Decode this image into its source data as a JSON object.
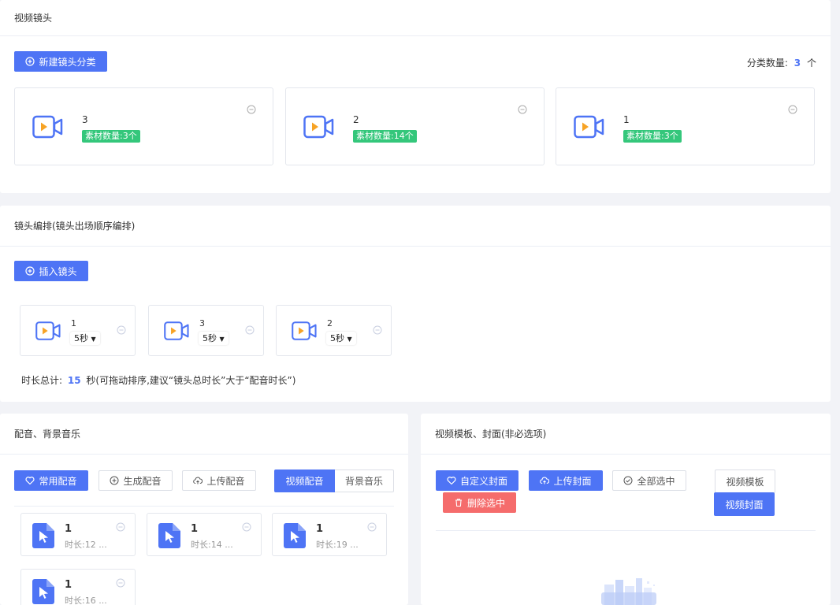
{
  "colors": {
    "primary": "#4e74f5",
    "success": "#34c77b",
    "danger": "#f56c6c"
  },
  "video_shots": {
    "title": "视频镜头",
    "new_category_button": "新建镜头分类",
    "count_label": "分类数量:",
    "count_value": "3",
    "count_unit": "个",
    "categories": [
      {
        "name": "3",
        "badge": "素材数量:3个"
      },
      {
        "name": "2",
        "badge": "素材数量:14个"
      },
      {
        "name": "1",
        "badge": "素材数量:3个"
      }
    ]
  },
  "arrangement": {
    "title": "镜头编排(镜头出场顺序编排)",
    "insert_button": "插入镜头",
    "shots": [
      {
        "name": "1",
        "duration": "5秒"
      },
      {
        "name": "3",
        "duration": "5秒"
      },
      {
        "name": "2",
        "duration": "5秒"
      }
    ],
    "total_label": "时长总计:",
    "total_value": "15",
    "total_suffix": "秒(可拖动排序,建议“镜头总时长”大于“配音时长”)"
  },
  "audio": {
    "title": "配音、背景音乐",
    "common_button": "常用配音",
    "generate_button": "生成配音",
    "upload_button": "上传配音",
    "tab_voice": "视频配音",
    "tab_music": "背景音乐",
    "items": [
      {
        "name": "1",
        "duration": "时长:12 ..."
      },
      {
        "name": "1",
        "duration": "时长:14 ..."
      },
      {
        "name": "1",
        "duration": "时长:19 ..."
      },
      {
        "name": "1",
        "duration": "时长:16 ..."
      }
    ]
  },
  "template": {
    "title": "视频模板、封面(非必选项)",
    "custom_cover_button": "自定义封面",
    "upload_cover_button": "上传封面",
    "select_all_button": "全部选中",
    "delete_selected_button": "删除选中",
    "tab_template": "视频模板",
    "tab_cover": "视频封面"
  }
}
